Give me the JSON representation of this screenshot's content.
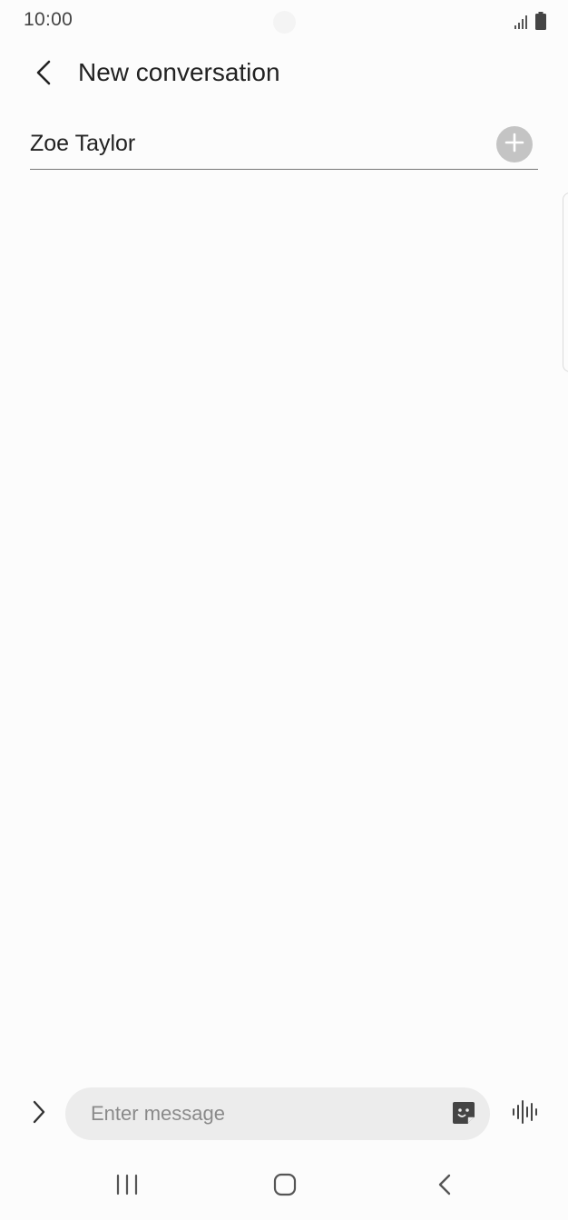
{
  "status_bar": {
    "time": "10:00",
    "icons": [
      "signal-icon",
      "battery-icon"
    ]
  },
  "header": {
    "title": "New conversation",
    "back_icon": "back-arrow-icon"
  },
  "recipient": {
    "value": "Zoe Taylor",
    "add_icon": "plus-circle-icon"
  },
  "composer": {
    "expand_icon": "chevron-right-icon",
    "placeholder": "Enter message",
    "value": "",
    "sticker_icon": "sticker-icon",
    "voice_icon": "voice-waveform-icon"
  },
  "nav_bar": {
    "buttons": [
      "recent-apps-icon",
      "home-icon",
      "back-icon"
    ]
  },
  "colors": {
    "background": "#fcfcfc",
    "text": "#222222",
    "field_bg": "#ececec",
    "add_button": "#c4c4c4",
    "divider": "#777777"
  }
}
